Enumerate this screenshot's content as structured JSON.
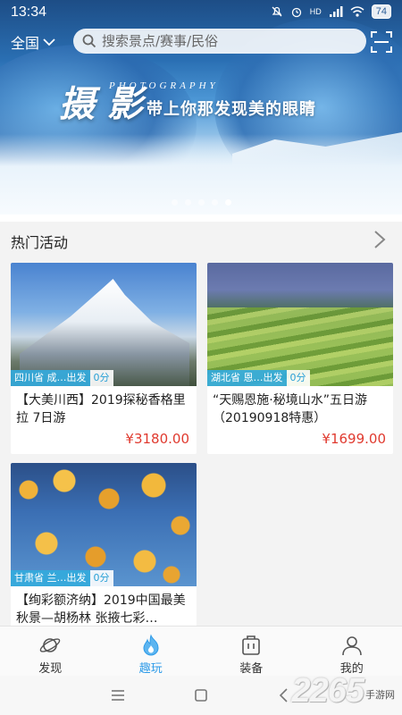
{
  "status_bar": {
    "time": "13:34",
    "network": "HD",
    "battery": "74"
  },
  "header": {
    "region": "全国",
    "search_placeholder": "搜索景点/赛事/民俗"
  },
  "banner": {
    "slogan_big": "摄 影",
    "slogan_en": "PHOTOGRAPHY",
    "slogan_cn": "带上你那发现美的眼睛",
    "slide_count": 5,
    "active_slide": 5
  },
  "section": {
    "title": "热门活动"
  },
  "activities": [
    {
      "location": "四川省 成…出发",
      "score": "0分",
      "title": "【大美川西】2019探秘香格里拉 7日游",
      "price": "¥3180.00"
    },
    {
      "location": "湖北省 恩…出发",
      "score": "0分",
      "title": "“天赐恩施·秘境山水”五日游（20190918特惠）",
      "price": "¥1699.00"
    },
    {
      "location": "甘肃省 兰…出发",
      "score": "0分",
      "title": "【绚彩额济纳】2019中国最美秋景—胡杨林 张掖七彩…",
      "price": ""
    }
  ],
  "tabs": [
    {
      "label": "发现",
      "icon": "planet-icon",
      "active": false
    },
    {
      "label": "趣玩",
      "icon": "flame-icon",
      "active": true
    },
    {
      "label": "装备",
      "icon": "bag-icon",
      "active": false
    },
    {
      "label": "我的",
      "icon": "user-icon",
      "active": false
    }
  ],
  "watermark": {
    "number": "2265",
    "site": "手游网"
  },
  "colors": {
    "accent": "#2e9be8",
    "price": "#e03a2f",
    "tag": "#34aadc"
  }
}
